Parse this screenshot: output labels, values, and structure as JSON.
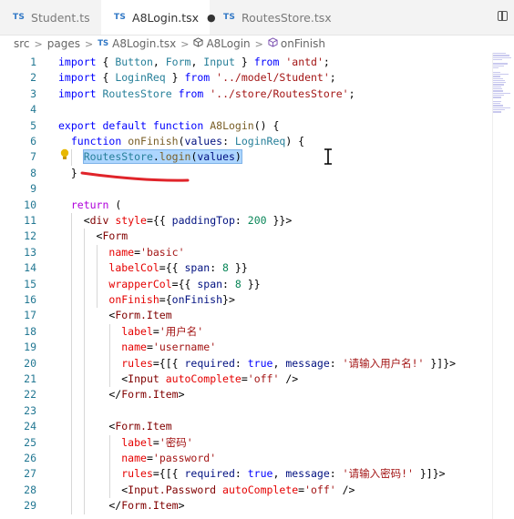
{
  "tabs": [
    {
      "lang": "TS",
      "label": "Student.ts",
      "active": false,
      "dirty": false
    },
    {
      "lang": "TS",
      "label": "A8Login.tsx",
      "active": true,
      "dirty": true
    },
    {
      "lang": "TS",
      "label": "RoutesStore.tsx",
      "active": false,
      "dirty": false
    }
  ],
  "dirty_marker": "●",
  "breadcrumb": {
    "items": [
      "src",
      "pages",
      "A8Login.tsx",
      "A8Login",
      "onFinish"
    ],
    "lang": "TS",
    "separator": ">"
  },
  "line_numbers": [
    "1",
    "2",
    "3",
    "4",
    "5",
    "6",
    "7",
    "8",
    "9",
    "10",
    "11",
    "12",
    "13",
    "14",
    "15",
    "16",
    "17",
    "18",
    "19",
    "20",
    "21",
    "22",
    "23",
    "24",
    "25",
    "26",
    "27",
    "28",
    "29"
  ],
  "code": [
    "import { Button, Form, Input } from 'antd';",
    "import { LoginReq } from '../model/Student';",
    "import RoutesStore from '../store/RoutesStore';",
    "",
    "export default function A8Login() {",
    "  function onFinish(values: LoginReq) {",
    "    RoutesStore.login(values)",
    "  }",
    "",
    "  return (",
    "    <div style={{ paddingTop: 200 }}>",
    "      <Form",
    "        name='basic'",
    "        labelCol={{ span: 8 }}",
    "        wrapperCol={{ span: 8 }}",
    "        onFinish={onFinish}>",
    "        <Form.Item",
    "          label='用户名'",
    "          name='username'",
    "          rules={[{ required: true, message: '请输入用户名!' }]}>",
    "          <Input autoComplete='off' />",
    "        </Form.Item>",
    "",
    "        <Form.Item",
    "          label='密码'",
    "          name='password'",
    "          rules={[{ required: true, message: '请输入密码!' }]}>",
    "          <Input.Password autoComplete='off' />",
    "        </Form.Item>"
  ],
  "colors": {
    "keyword": "#0000ff",
    "control_keyword": "#af00db",
    "function": "#795e26",
    "type": "#267f99",
    "variable": "#001080",
    "string": "#a31515",
    "tag": "#800000",
    "attribute": "#e50000",
    "number": "#098658",
    "line_number": "#237893",
    "selection": "#add6ff",
    "annotation_stroke": "#e0242a"
  },
  "icons": {
    "lightbulb": "lightbulb-icon",
    "split_editor": "split-editor-icon",
    "symbol": "cube-icon",
    "text_cursor": "ibeam-cursor-icon"
  }
}
